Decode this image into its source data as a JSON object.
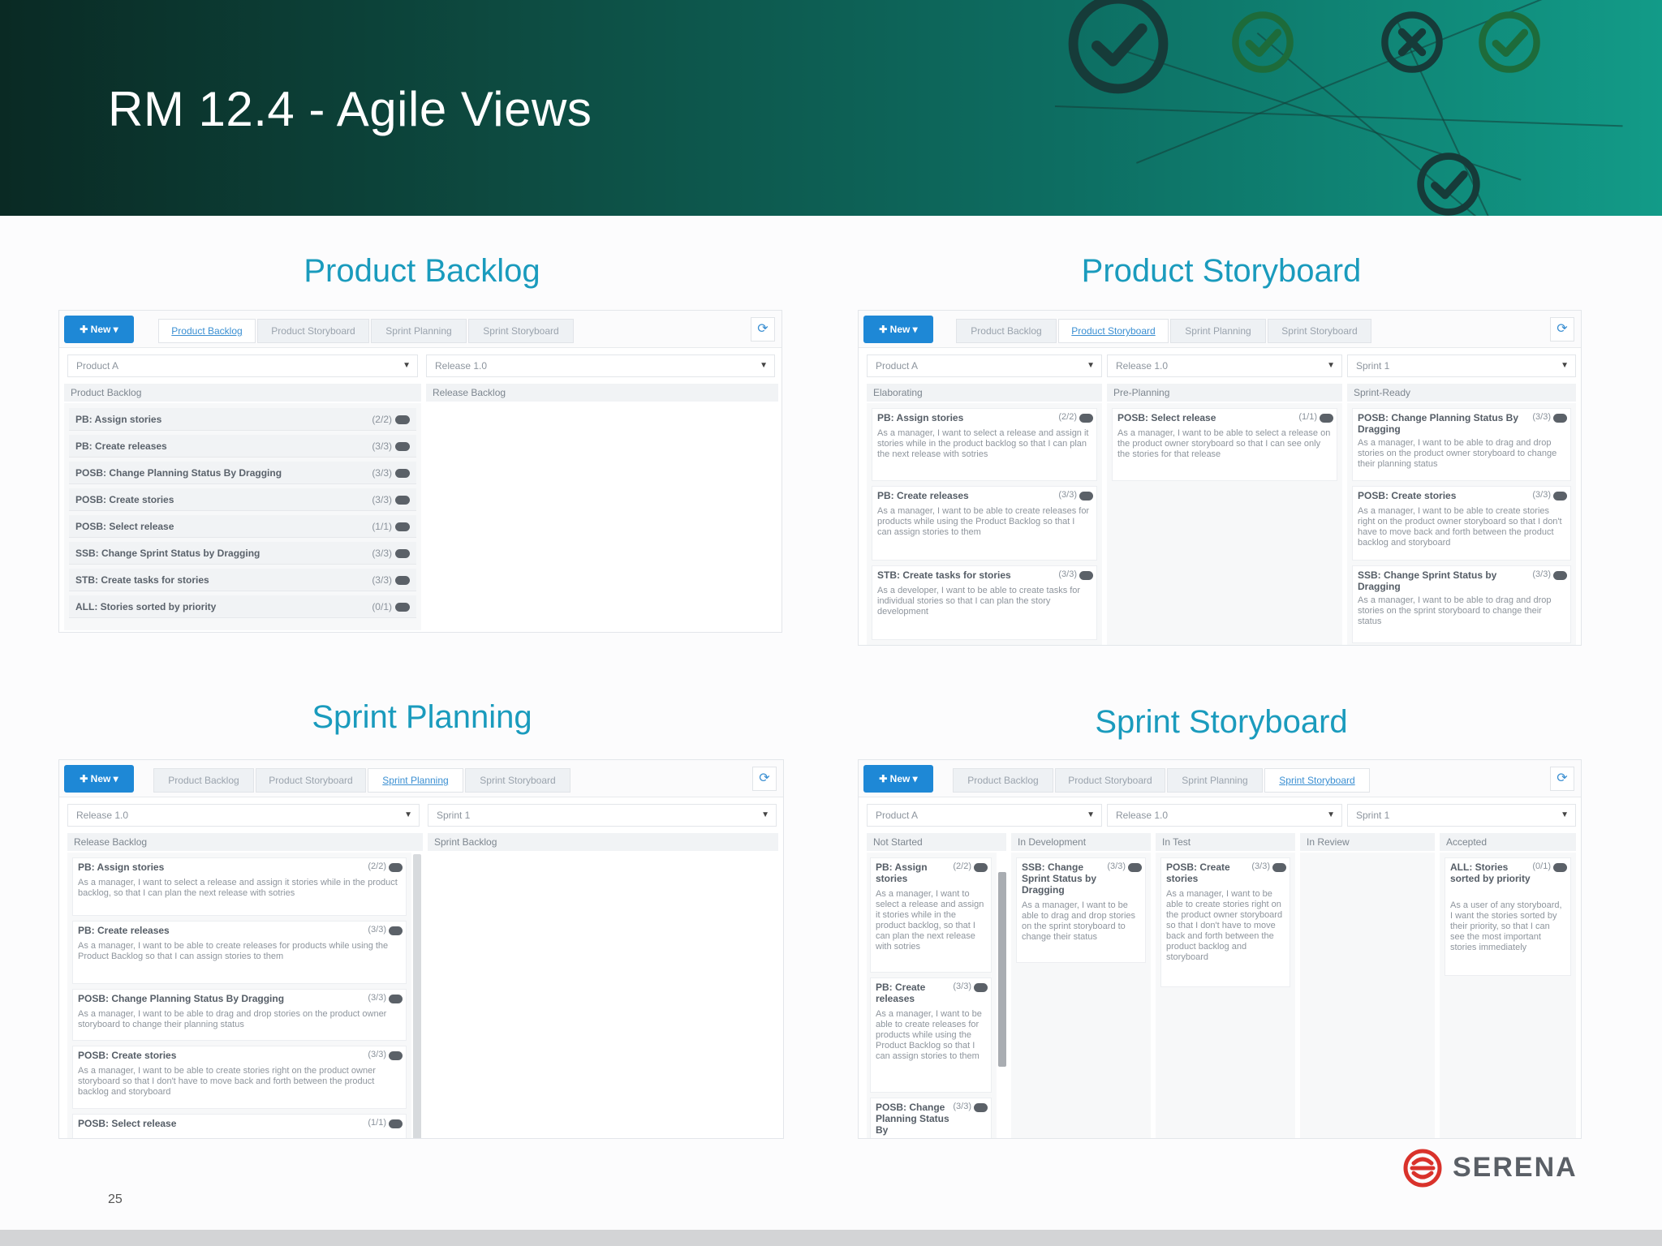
{
  "slide": {
    "title": "RM 12.4 - Agile Views",
    "page_number": "25",
    "logo_text": "SERENA"
  },
  "colors": {
    "accent": "#1a9bbd",
    "button_blue": "#1e88d6",
    "logo_red": "#d9322b"
  },
  "common": {
    "new_button": "✚ New ▾",
    "refresh_icon": "⟳",
    "tabs": [
      "Product Backlog",
      "Product Storyboard",
      "Sprint Planning",
      "Sprint Storyboard"
    ]
  },
  "product_backlog": {
    "title": "Product Backlog",
    "product_select": "Product A",
    "release_select": "Release 1.0",
    "left_header": "Product Backlog",
    "right_header": "Release Backlog",
    "rows": [
      {
        "label": "PB: Assign stories",
        "count": "(2/2)"
      },
      {
        "label": "PB: Create releases",
        "count": "(3/3)"
      },
      {
        "label": "POSB: Change Planning Status By Dragging",
        "count": "(3/3)"
      },
      {
        "label": "POSB: Create stories",
        "count": "(3/3)"
      },
      {
        "label": "POSB: Select release",
        "count": "(1/1)"
      },
      {
        "label": "SSB: Change Sprint Status by Dragging",
        "count": "(3/3)"
      },
      {
        "label": "STB: Create tasks for stories",
        "count": "(3/3)"
      },
      {
        "label": "ALL: Stories sorted by priority",
        "count": "(0/1)"
      }
    ]
  },
  "product_storyboard": {
    "title": "Product Storyboard",
    "product_select": "Product A",
    "release_select": "Release 1.0",
    "sprint_select": "Sprint 1",
    "columns": [
      {
        "header": "Elaborating",
        "cards": [
          {
            "title": "PB: Assign stories",
            "count": "(2/2)",
            "desc": "As a manager, I want to select a release and assign it stories while in the product backlog so that I can plan the next release with sotries"
          },
          {
            "title": "PB: Create releases",
            "count": "(3/3)",
            "desc": "As a manager, I want to be able to create releases for products while using the Product Backlog so that I can assign stories to them"
          },
          {
            "title": "STB: Create tasks for stories",
            "count": "(3/3)",
            "desc": "As a developer, I want to be able to create tasks for individual stories so that I can plan the story development"
          }
        ]
      },
      {
        "header": "Pre-Planning",
        "cards": [
          {
            "title": "POSB: Select release",
            "count": "(1/1)",
            "desc": "As a manager, I want to be able to select a release on the product owner storyboard so that I can see only the stories for that release"
          }
        ]
      },
      {
        "header": "Sprint-Ready",
        "cards": [
          {
            "title": "POSB: Change Planning Status By Dragging",
            "count": "(3/3)",
            "desc": "As a manager, I want to be able to drag and drop stories on the product owner storyboard to change their planning status"
          },
          {
            "title": "POSB: Create stories",
            "count": "(3/3)",
            "desc": "As a manager, I want to be able to create stories right on the product owner storyboard so that I don't have to move back and forth between the product backlog and storyboard"
          },
          {
            "title": "SSB: Change Sprint Status by Dragging",
            "count": "(3/3)",
            "desc": "As a manager, I want to be able to drag and drop stories on the sprint storyboard to change their status"
          }
        ]
      }
    ]
  },
  "sprint_planning": {
    "title": "Sprint Planning",
    "release_select": "Release 1.0",
    "sprint_select": "Sprint 1",
    "left_header": "Release Backlog",
    "right_header": "Sprint Backlog",
    "cards": [
      {
        "title": "PB: Assign stories",
        "count": "(2/2)",
        "desc": "As a manager, I want to select a release and assign it stories while in the product backlog, so that I can plan the next release with sotries"
      },
      {
        "title": "PB: Create releases",
        "count": "(3/3)",
        "desc": "As a manager, I want to be able to create releases for products while using the Product Backlog so that I can assign stories to them"
      },
      {
        "title": "POSB: Change Planning Status By Dragging",
        "count": "(3/3)",
        "desc": "As a manager, I want to be able to drag and drop stories on the product owner storyboard to change their planning status"
      },
      {
        "title": "POSB: Create stories",
        "count": "(3/3)",
        "desc": "As a manager, I want to be able to create stories right on the product owner storyboard so that I don't have to move back and forth between the product backlog and storyboard"
      },
      {
        "title": "POSB: Select release",
        "count": "(1/1)",
        "desc": ""
      }
    ]
  },
  "sprint_storyboard": {
    "title": "Sprint Storyboard",
    "product_select": "Product A",
    "release_select": "Release 1.0",
    "sprint_select": "Sprint 1",
    "columns": [
      {
        "header": "Not Started",
        "cards": [
          {
            "title": "PB: Assign stories",
            "count": "(2/2)",
            "desc": "As a manager, I want to select a release and assign it stories while in the product backlog, so that I can plan the next release with sotries"
          },
          {
            "title": "PB: Create releases",
            "count": "(3/3)",
            "desc": "As a manager, I want to be able to create releases for products while using the Product Backlog so that I can assign stories to them"
          },
          {
            "title": "POSB: Change Planning Status By",
            "count": "(3/3)",
            "desc": ""
          }
        ]
      },
      {
        "header": "In Development",
        "cards": [
          {
            "title": "SSB: Change Sprint Status by Dragging",
            "count": "(3/3)",
            "desc": "As a manager, I want to be able to drag and drop stories on the sprint storyboard to change their status"
          }
        ]
      },
      {
        "header": "In Test",
        "cards": [
          {
            "title": "POSB: Create stories",
            "count": "(3/3)",
            "desc": "As a manager, I want to be able to create stories right on the product owner storyboard so that I don't have to move back and forth between the product backlog and storyboard"
          }
        ]
      },
      {
        "header": "In Review",
        "cards": []
      },
      {
        "header": "Accepted",
        "cards": [
          {
            "title": "ALL: Stories sorted by priority",
            "count": "(0/1)",
            "desc": "As a user of any storyboard, I want the stories sorted by their priority, so that I can see the most important stories immediately"
          }
        ]
      }
    ]
  }
}
